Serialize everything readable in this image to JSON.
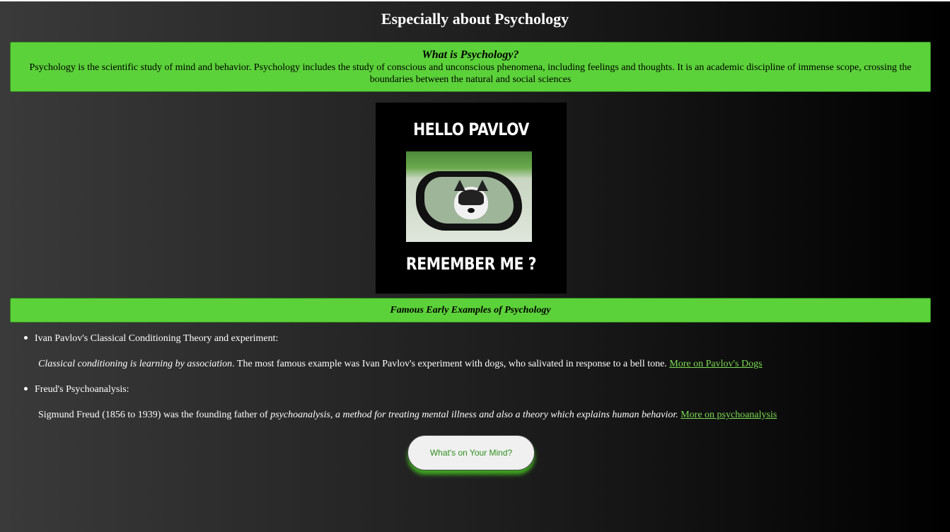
{
  "page": {
    "heading": "Especially about Psychology"
  },
  "intro": {
    "title": "What is Psychology?",
    "text": "Psychology is the scientific study of mind and behavior. Psychology includes the study of conscious and unconscious phenomena, including feelings and thoughts. It is an academic discipline of immense scope, crossing the boundaries between the natural and social sciences"
  },
  "meme": {
    "top_text": "HELLO PAVLOV",
    "bottom_text": "REMEMBER ME ?"
  },
  "examples": {
    "title": "Famous Early Examples of Psychology",
    "items": [
      {
        "bullet": "Ivan Pavlov's Classical Conditioning Theory and experiment:",
        "italic": "Classical conditioning is learning by association",
        "text": ". The most famous example was Ivan Pavlov's experiment with dogs, who salivated in response to a bell tone. ",
        "link": "More on Pavlov's Dogs"
      },
      {
        "bullet": "Freud's Psychoanalysis:",
        "lead": "Sigmund Freud (1856 to 1939) was the founding father of ",
        "italic": "psychoanalysis, a method for treating mental illness and also a theory which explains human behavior.",
        "link": "More on psychoanalysis"
      }
    ]
  },
  "button": {
    "label": "What's on Your Mind?"
  },
  "colors": {
    "accent_green": "#5cd23a",
    "link_green": "#7ddc54"
  }
}
